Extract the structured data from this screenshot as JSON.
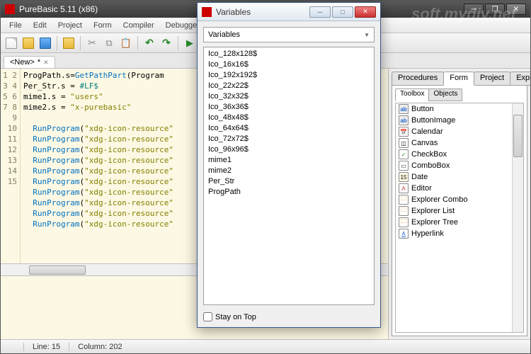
{
  "window": {
    "title": "PureBasic 5.11 (x86)"
  },
  "watermark": "soft.mydiv.net",
  "menu": [
    "File",
    "Edit",
    "Project",
    "Form",
    "Compiler",
    "Debugger"
  ],
  "doc_tab": {
    "label": "<New>",
    "dirty": "*"
  },
  "code": {
    "lines": [
      1,
      2,
      3,
      4,
      5,
      6,
      7,
      8,
      9,
      10,
      11,
      12,
      13,
      14,
      15
    ],
    "rows": [
      {
        "t": "assign",
        "lhs": "ProgPath.s",
        "fn": "GetPathPart",
        "arg": "Program"
      },
      {
        "t": "assign",
        "lhs": "Per_Str.s",
        "const": "#LF$"
      },
      {
        "t": "assign",
        "lhs": "mime1.s",
        "str": "\"users\""
      },
      {
        "t": "assign",
        "lhs": "mime2.s",
        "str": "\"x-purebasic\""
      },
      {
        "t": "blank"
      },
      {
        "t": "call",
        "fn": "RunProgram",
        "str": "\"xdg-icon-resource\""
      },
      {
        "t": "call",
        "fn": "RunProgram",
        "str": "\"xdg-icon-resource\""
      },
      {
        "t": "call",
        "fn": "RunProgram",
        "str": "\"xdg-icon-resource\""
      },
      {
        "t": "call",
        "fn": "RunProgram",
        "str": "\"xdg-icon-resource\""
      },
      {
        "t": "call",
        "fn": "RunProgram",
        "str": "\"xdg-icon-resource\""
      },
      {
        "t": "call",
        "fn": "RunProgram",
        "str": "\"xdg-icon-resource\""
      },
      {
        "t": "call",
        "fn": "RunProgram",
        "str": "\"xdg-icon-resource\""
      },
      {
        "t": "call",
        "fn": "RunProgram",
        "str": "\"xdg-icon-resource\""
      },
      {
        "t": "call",
        "fn": "RunProgram",
        "str": "\"xdg-icon-resource\""
      },
      {
        "t": "call",
        "fn": "RunProgram",
        "str": "\"xdg-icon-resource\""
      }
    ]
  },
  "side": {
    "tabs": [
      "Procedures",
      "Form",
      "Project",
      "Explorer"
    ],
    "active_tab": 1,
    "subtabs": [
      "Toolbox",
      "Objects"
    ],
    "active_subtab": 0,
    "toolbox": [
      {
        "icon": "button",
        "label": "Button"
      },
      {
        "icon": "button",
        "label": "ButtonImage"
      },
      {
        "icon": "cal",
        "label": "Calendar"
      },
      {
        "icon": "canvas",
        "label": "Canvas"
      },
      {
        "icon": "check",
        "label": "CheckBox"
      },
      {
        "icon": "combo",
        "label": "ComboBox"
      },
      {
        "icon": "date",
        "label": "Date"
      },
      {
        "icon": "editor",
        "label": "Editor"
      },
      {
        "icon": "exp",
        "label": "Explorer Combo"
      },
      {
        "icon": "exp",
        "label": "Explorer List"
      },
      {
        "icon": "exp",
        "label": "Explorer Tree"
      },
      {
        "icon": "hyper",
        "label": "Hyperlink"
      }
    ]
  },
  "status": {
    "line_label": "Line:",
    "line": "15",
    "col_label": "Column:",
    "col": "202"
  },
  "dialog": {
    "title": "Variables",
    "combo": "Variables",
    "items": [
      "Ico_128x128$",
      "Ico_16x16$",
      "Ico_192x192$",
      "Ico_22x22$",
      "Ico_32x32$",
      "Ico_36x36$",
      "Ico_48x48$",
      "Ico_64x64$",
      "Ico_72x72$",
      "Ico_96x96$",
      "mime1",
      "mime2",
      "Per_Str",
      "ProgPath"
    ],
    "stay_label": "Stay on Top"
  }
}
